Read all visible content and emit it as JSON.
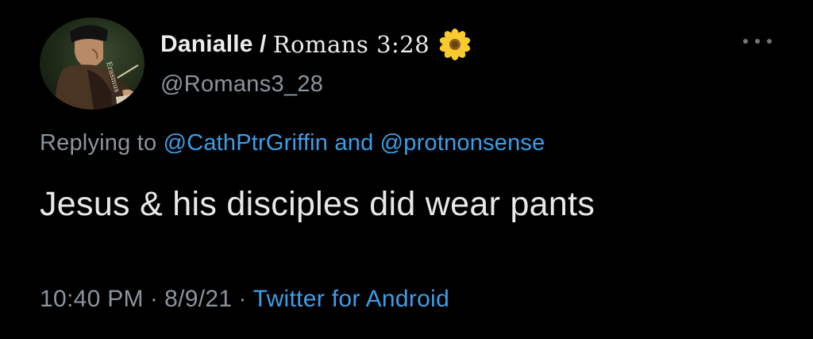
{
  "author": {
    "display_name": "Danialle /",
    "display_name_fancy": "Romans 3:28",
    "emoji": "sunflower-icon",
    "handle": "@Romans3_28",
    "avatar_label": "Erasmus"
  },
  "reply": {
    "prefix": "Replying to",
    "mention_1": "@CathPtrGriffin",
    "conjunction": "and",
    "mention_2": "@protnonsense"
  },
  "tweet": {
    "text": "Jesus & his disciples did wear pants"
  },
  "meta": {
    "time": "10:40 PM",
    "separator": "·",
    "date": "8/9/21",
    "source": "Twitter for Android"
  },
  "colors": {
    "background": "#000000",
    "link": "#3b9ee8",
    "secondary_text": "#8b949c",
    "primary_text": "#e8e8e8"
  }
}
